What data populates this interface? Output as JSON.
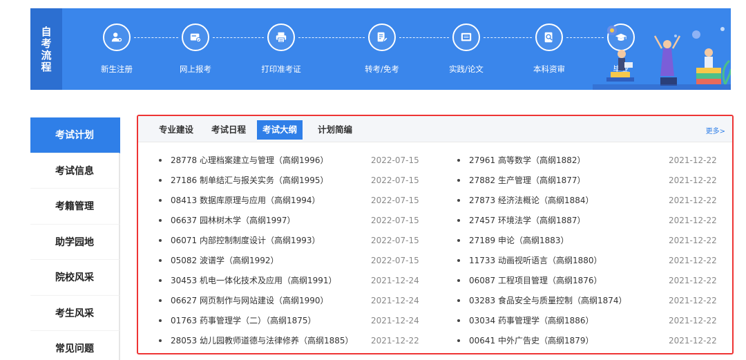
{
  "banner": {
    "label_chars": [
      "自",
      "考",
      "流",
      "程"
    ],
    "steps": [
      {
        "label": "新生注册",
        "icon": "user-add-icon"
      },
      {
        "label": "网上报考",
        "icon": "card-check-icon"
      },
      {
        "label": "打印准考证",
        "icon": "printer-icon"
      },
      {
        "label": "转考/免考",
        "icon": "document-edit-icon"
      },
      {
        "label": "实践/论文",
        "icon": "paper-icon"
      },
      {
        "label": "本科资审",
        "icon": "search-document-icon"
      },
      {
        "label": "毕业",
        "icon": "graduation-cap-icon"
      }
    ]
  },
  "sidenav": {
    "items": [
      {
        "label": "考试计划",
        "active": true
      },
      {
        "label": "考试信息",
        "active": false
      },
      {
        "label": "考籍管理",
        "active": false
      },
      {
        "label": "助学园地",
        "active": false
      },
      {
        "label": "院校风采",
        "active": false
      },
      {
        "label": "考生风采",
        "active": false
      },
      {
        "label": "常见问题",
        "active": false
      }
    ]
  },
  "tabs": {
    "items": [
      {
        "label": "专业建设",
        "active": false
      },
      {
        "label": "考试日程",
        "active": false
      },
      {
        "label": "考试大纲",
        "active": true
      },
      {
        "label": "计划简编",
        "active": false
      }
    ],
    "more_label": "更多>"
  },
  "list_left": [
    {
      "title": "28778 心理档案建立与管理（高纲1996）",
      "date": "2022-07-15"
    },
    {
      "title": "27186 制单结汇与报关实务（高纲1995）",
      "date": "2022-07-15"
    },
    {
      "title": "08413 数据库原理与应用（高纲1994）",
      "date": "2022-07-15"
    },
    {
      "title": "06637 园林树木学（高纲1997）",
      "date": "2022-07-15"
    },
    {
      "title": "06071 内部控制制度设计（高纲1993）",
      "date": "2022-07-15"
    },
    {
      "title": "05082 波谱学（高纲1992）",
      "date": "2022-07-15"
    },
    {
      "title": "30453 机电一体化技术及应用（高纲1991）",
      "date": "2021-12-24"
    },
    {
      "title": "06627 网页制作与网站建设（高纲1990）",
      "date": "2021-12-24"
    },
    {
      "title": "01763 药事管理学（二）（高纲1875）",
      "date": "2021-12-24"
    },
    {
      "title": "28053 幼儿园教师道德与法律修养（高纲1885）",
      "date": "2021-12-22"
    }
  ],
  "list_right": [
    {
      "title": "27961 高等数学（高纲1882）",
      "date": "2021-12-22"
    },
    {
      "title": "27882 生产管理（高纲1877）",
      "date": "2021-12-22"
    },
    {
      "title": "27873 经济法概论（高纲1884）",
      "date": "2021-12-22"
    },
    {
      "title": "27457 环境法学（高纲1887）",
      "date": "2021-12-22"
    },
    {
      "title": "27189 申论（高纲1883）",
      "date": "2021-12-22"
    },
    {
      "title": "11733 动画视听语言（高纲1880）",
      "date": "2021-12-22"
    },
    {
      "title": "06087 工程项目管理（高纲1876）",
      "date": "2021-12-22"
    },
    {
      "title": "03283 食品安全与质量控制（高纲1874）",
      "date": "2021-12-22"
    },
    {
      "title": "03034 药事管理学（高纲1886）",
      "date": "2021-12-22"
    },
    {
      "title": "00641 中外广告史（高纲1879）",
      "date": "2021-12-22"
    }
  ],
  "colors": {
    "banner_bg": "#3a86eb",
    "accent": "#2f7fe8",
    "highlight_border": "#e33"
  }
}
